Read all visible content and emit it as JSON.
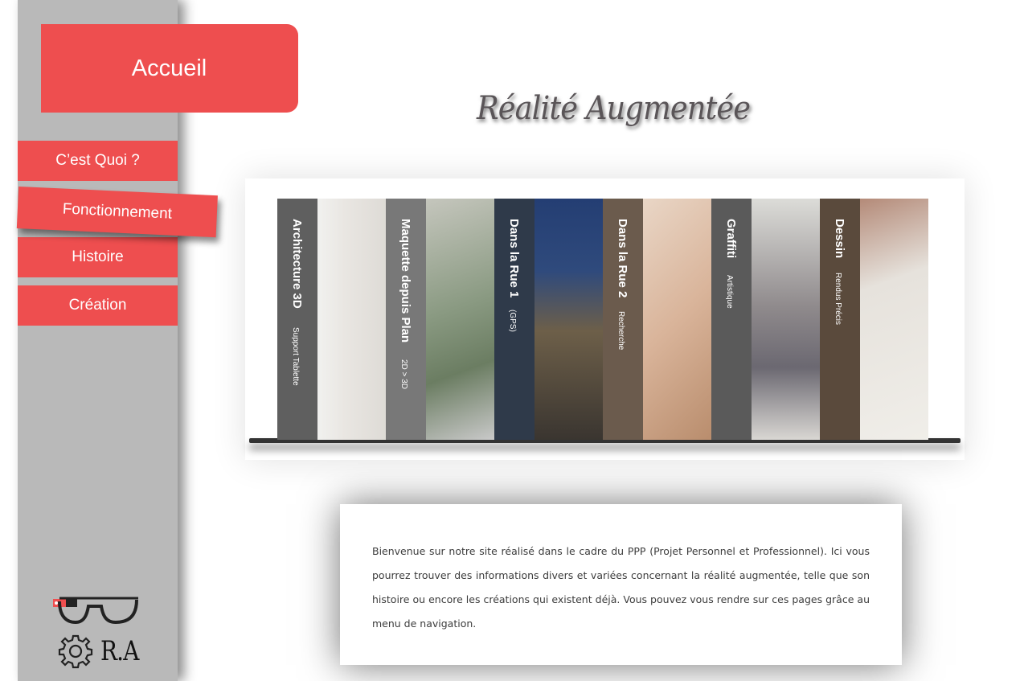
{
  "sidebar": {
    "home_label": "Accueil",
    "items": [
      {
        "label": "C’est Quoi ?"
      },
      {
        "label": "Fonctionnement",
        "active": true
      },
      {
        "label": "Histoire"
      },
      {
        "label": "Création"
      }
    ],
    "logo": {
      "icon": "ar-glasses-gear-icon",
      "text": "R.A"
    }
  },
  "main": {
    "title": "Réalité Augmentée",
    "slides": [
      {
        "title": "Architecture 3D",
        "subtitle": "Support Tablette"
      },
      {
        "title": "Maquette depuis Plan",
        "subtitle": "2D > 3D"
      },
      {
        "title": "Dans la Rue 1",
        "subtitle": "(GPS)"
      },
      {
        "title": "Dans la Rue 2",
        "subtitle": "Recherche"
      },
      {
        "title": "Graffiti",
        "subtitle": "Artistique"
      },
      {
        "title": "Dessin",
        "subtitle": "Rendus Précis"
      }
    ],
    "intro_text": "Bienvenue sur notre site réalisé dans le cadre du PPP (Projet Personnel et Professionnel). Ici vous pourrez trouver des informations divers et variées concernant la réalité augmentée, telle que son histoire ou encore les créations qui existent déjà. Vous pouvez vous rendre sur ces pages grâce au menu de navigation."
  },
  "colors": {
    "accent": "#ee4e4f",
    "sidebar_bg": "#b9b9b9",
    "title": "#5a5558"
  }
}
